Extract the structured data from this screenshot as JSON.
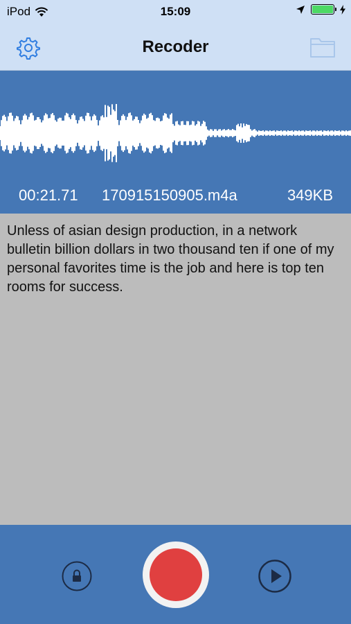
{
  "status_bar": {
    "carrier": "iPod",
    "time": "15:09",
    "icons": [
      "wifi-icon",
      "location-arrow-icon",
      "battery-icon",
      "charging-bolt-icon"
    ],
    "battery_level": 1.0,
    "battery_color": "#4cd964"
  },
  "nav": {
    "title": "Recoder",
    "left_icon": "gear-icon",
    "right_icon": "folder-icon",
    "accent": "#2f7de1"
  },
  "recording": {
    "duration": "00:21.71",
    "filename": "170915150905.m4a",
    "size": "349KB"
  },
  "transcript": {
    "text": "Unless of asian design production, in a network bulletin billion dollars in two thousand ten if one of my personal favorites time is the job and here is top ten rooms for success."
  },
  "toolbar": {
    "lock_icon": "lock-icon",
    "record_icon": "record-icon",
    "play_icon": "play-icon",
    "record_color": "#e04040"
  },
  "colors": {
    "bar_bg": "#cfe0f5",
    "panel_bg": "#4577b5",
    "text_bg": "#bcbcbc"
  }
}
